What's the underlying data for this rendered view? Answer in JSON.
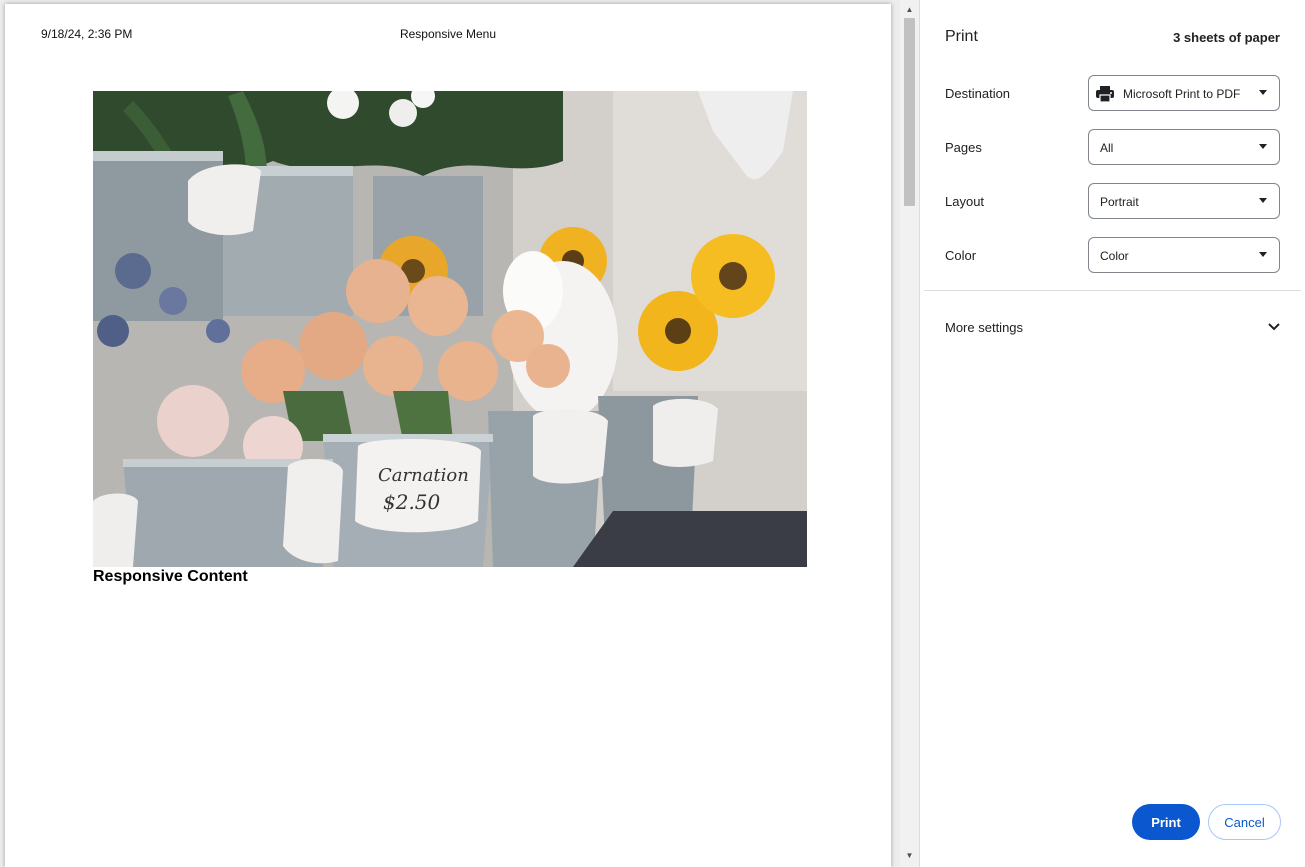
{
  "preview": {
    "header_date": "9/18/24, 2:36 PM",
    "header_title": "Responsive Menu",
    "content_heading": "Responsive Content",
    "image": {
      "description_icon": "flower-buckets-photo",
      "price_tag_line1": "Carnation",
      "price_tag_line2": "$2.50"
    }
  },
  "panel": {
    "title": "Print",
    "sheets": "3 sheets of paper",
    "destination": {
      "label": "Destination",
      "value": "Microsoft Print to PDF",
      "icon": "printer-icon"
    },
    "pages": {
      "label": "Pages",
      "value": "All"
    },
    "layout": {
      "label": "Layout",
      "value": "Portrait"
    },
    "color": {
      "label": "Color",
      "value": "Color"
    },
    "more_settings": "More settings",
    "print_button": "Print",
    "cancel_button": "Cancel"
  },
  "colors": {
    "accent": "#0b57d0",
    "border": "#80868b",
    "divider": "#dadce0"
  }
}
